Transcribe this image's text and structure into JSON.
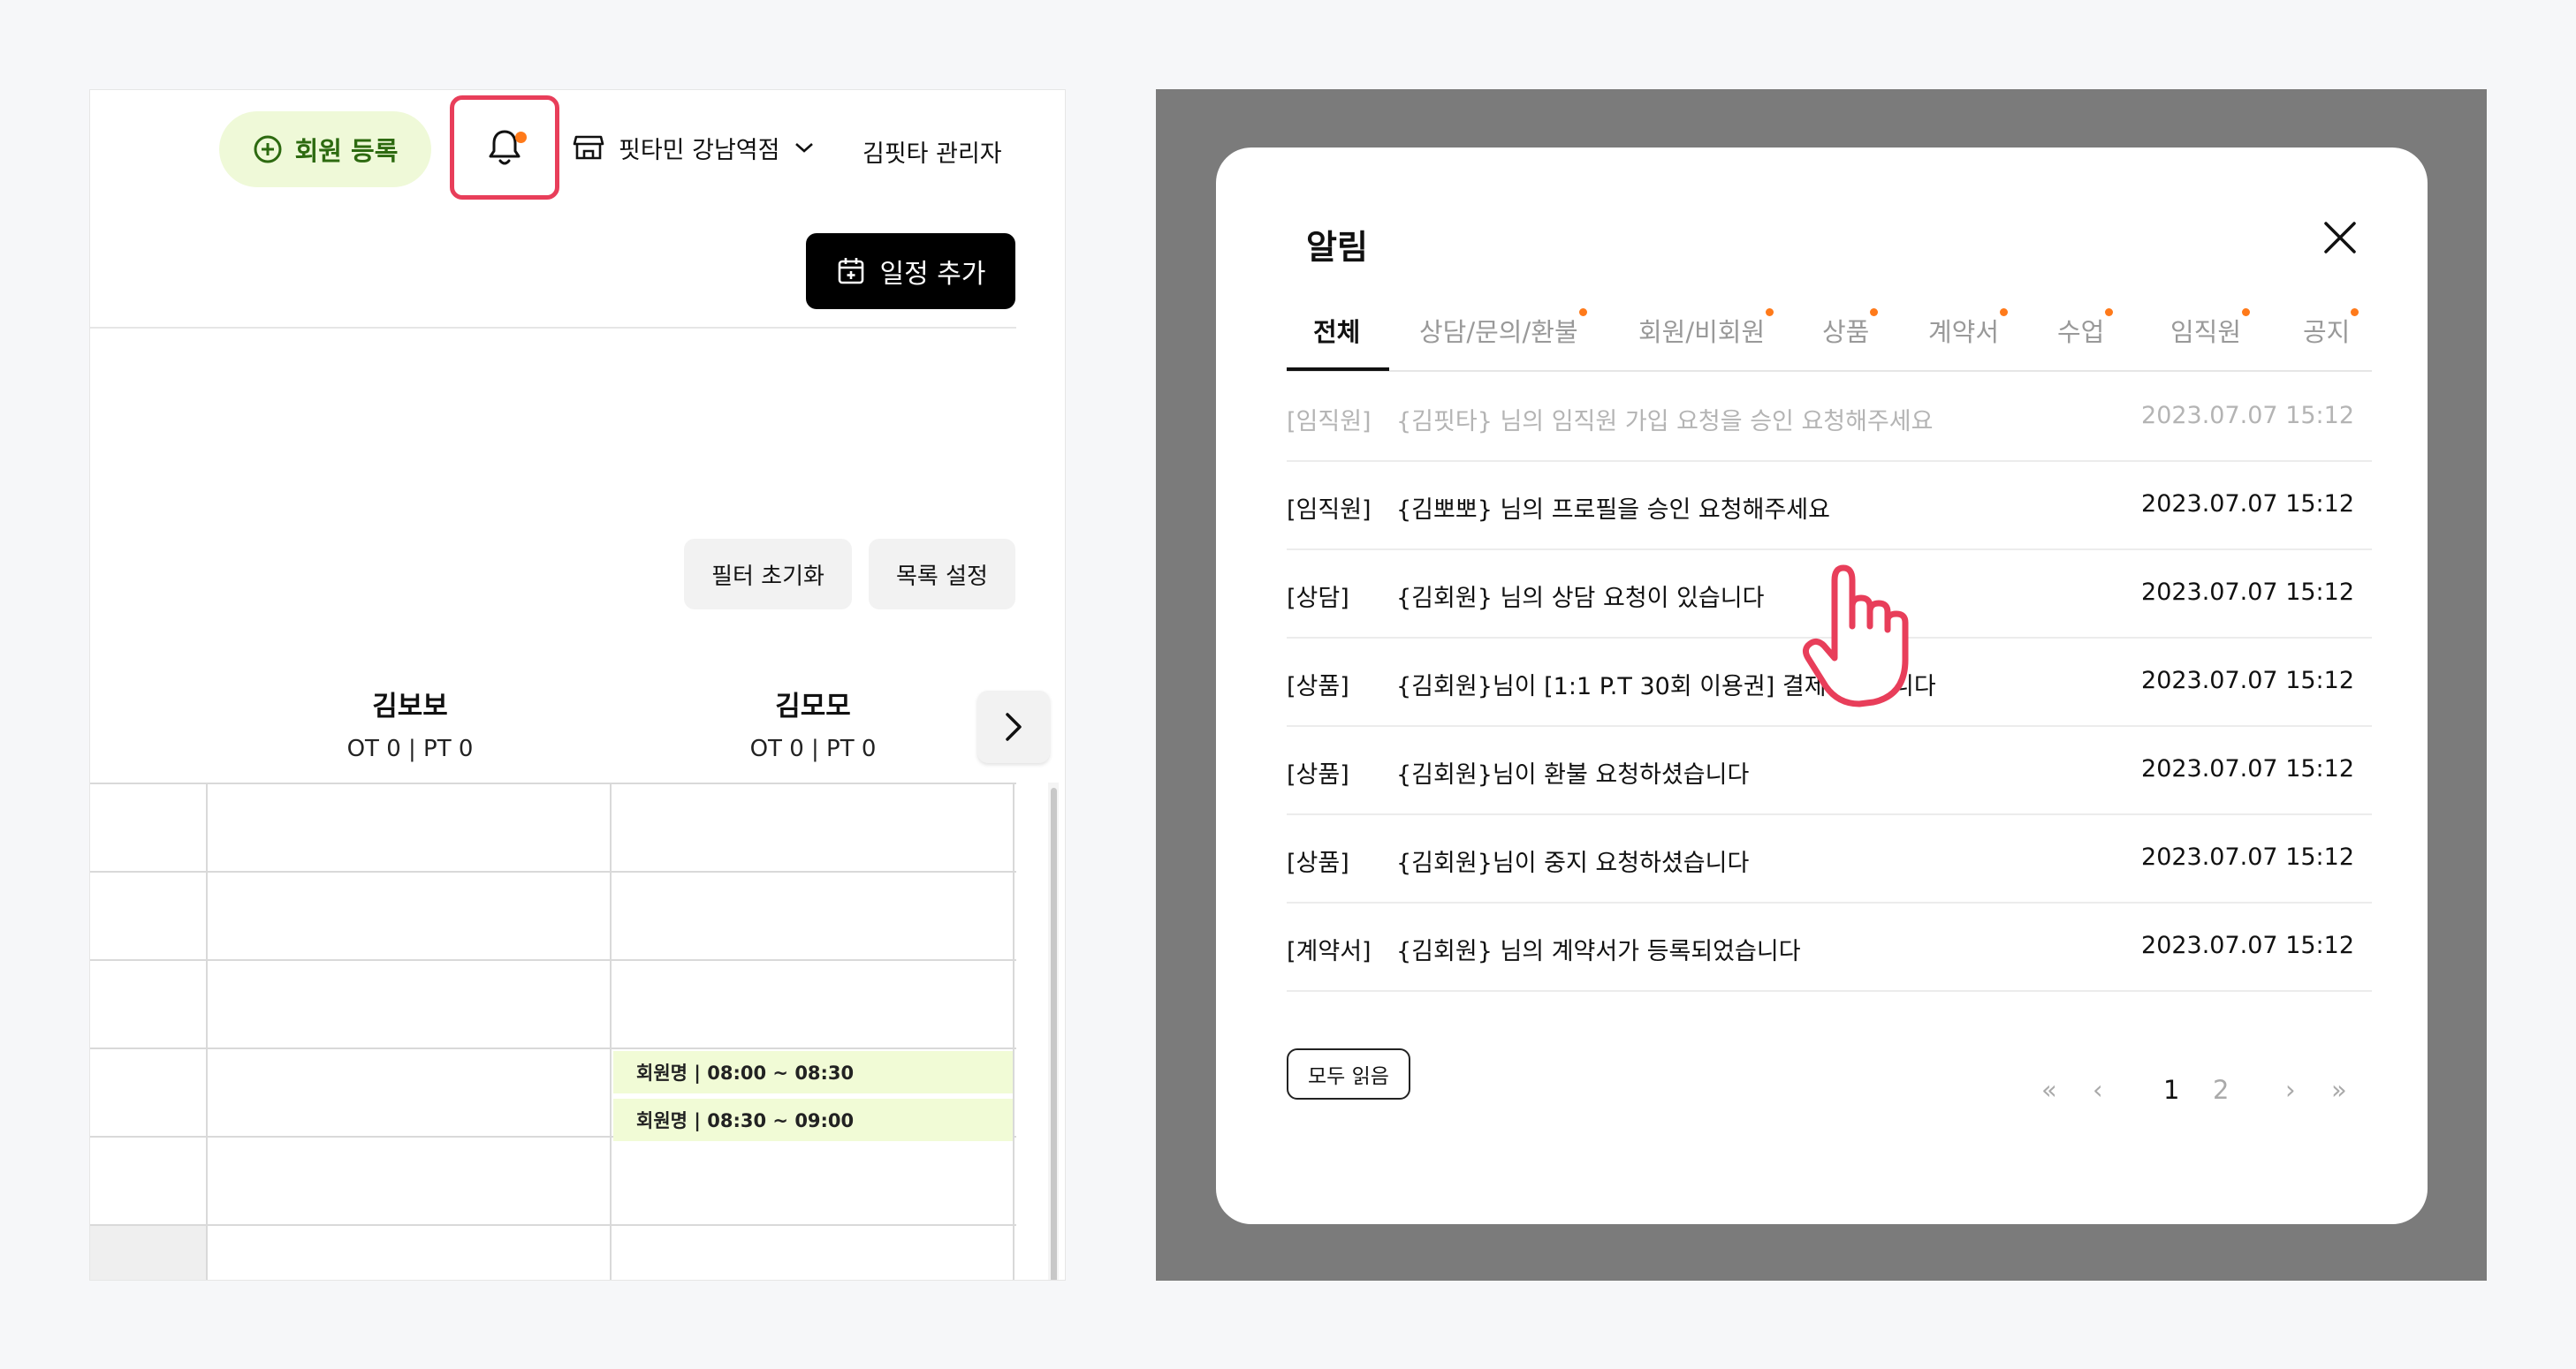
{
  "left": {
    "add_member_label": "회원 등록",
    "branch_label": "핏타민 강남역점",
    "admin_label": "김핏타 관리자",
    "add_schedule_label": "일정 추가",
    "filter_reset_label": "필터 초기화",
    "list_settings_label": "목록 설정",
    "staff": [
      {
        "name": "김보보",
        "counts": "OT 0 | PT 0"
      },
      {
        "name": "김모모",
        "counts": "OT 0 | PT 0"
      }
    ],
    "events": [
      {
        "label": "회원명 | 08:00 ~ 08:30"
      },
      {
        "label": "회원명 | 08:30 ~ 09:00"
      }
    ],
    "colors": {
      "highlight_border": "#e83e5a",
      "notification_dot": "#ff7a1a",
      "member_btn_bg": "#eff9d8",
      "member_btn_text": "#2d6a10",
      "event_bg": "#f1fbd6"
    }
  },
  "modal": {
    "title": "알림",
    "tabs": [
      {
        "label": "전체",
        "active": true,
        "dot": false
      },
      {
        "label": "상담/문의/환불",
        "active": false,
        "dot": true
      },
      {
        "label": "회원/비회원",
        "active": false,
        "dot": true
      },
      {
        "label": "상품",
        "active": false,
        "dot": true
      },
      {
        "label": "계약서",
        "active": false,
        "dot": true
      },
      {
        "label": "수업",
        "active": false,
        "dot": true
      },
      {
        "label": "임직원",
        "active": false,
        "dot": true
      },
      {
        "label": "공지",
        "active": false,
        "dot": true
      }
    ],
    "notifications": [
      {
        "category": "[임직원]",
        "message": "{김핏타} 님의 임직원 가입 요청을 승인 요청해주세요",
        "time": "2023.07.07  15:12",
        "read": true
      },
      {
        "category": "[임직원]",
        "message": "{김뽀뽀} 님의 프로필을 승인 요청해주세요",
        "time": "2023.07.07  15:12",
        "read": false
      },
      {
        "category": "[상담]",
        "message": "{김회원} 님의 상담 요청이 있습니다",
        "time": "2023.07.07  15:12",
        "read": false
      },
      {
        "category": "[상품]",
        "message": "{김회원}님이 [1:1 P.T 30회 이용권] 결제하셨습니다",
        "time": "2023.07.07  15:12",
        "read": false
      },
      {
        "category": "[상품]",
        "message": "{김회원}님이 환불 요청하셨습니다",
        "time": "2023.07.07  15:12",
        "read": false
      },
      {
        "category": "[상품]",
        "message": "{김회원}님이 중지 요청하셨습니다",
        "time": "2023.07.07  15:12",
        "read": false
      },
      {
        "category": "[계약서]",
        "message": "{김회원} 님의 계약서가 등록되었습니다",
        "time": "2023.07.07  15:12",
        "read": false
      }
    ],
    "mark_all_read_label": "모두 읽음",
    "pagination": {
      "first": "«",
      "prev": "‹",
      "pages": [
        "1",
        "2"
      ],
      "current": "1",
      "next": "›",
      "last": "»"
    }
  }
}
